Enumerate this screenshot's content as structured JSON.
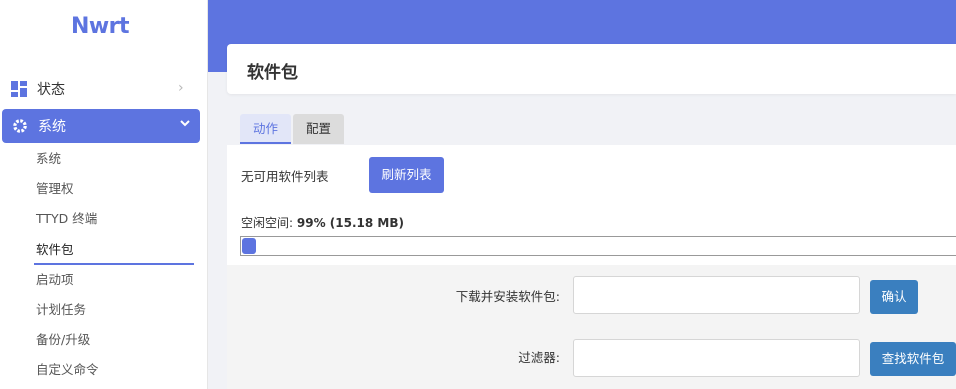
{
  "app": {
    "logo": "Nwrt"
  },
  "sidebar": {
    "status": {
      "label": "状态"
    },
    "system": {
      "label": "系统"
    },
    "submenu": [
      {
        "label": "系统",
        "active": false
      },
      {
        "label": "管理权",
        "active": false
      },
      {
        "label": "TTYD 终端",
        "active": false
      },
      {
        "label": "软件包",
        "active": true
      },
      {
        "label": "启动项",
        "active": false
      },
      {
        "label": "计划任务",
        "active": false
      },
      {
        "label": "备份/升级",
        "active": false
      },
      {
        "label": "自定义命令",
        "active": false
      }
    ]
  },
  "page": {
    "title": "软件包"
  },
  "tabs": [
    {
      "label": "动作",
      "active": true
    },
    {
      "label": "配置",
      "active": false
    }
  ],
  "actions": {
    "no_list_text": "无可用软件列表",
    "refresh_button": "刷新列表",
    "free_space_label": "空闲空间:",
    "free_space_value": "99% (15.18 MB)",
    "used_fraction": 0.02
  },
  "form": {
    "download_label": "下载并安装软件包:",
    "download_value": "",
    "confirm_button": "确认",
    "filter_label": "过滤器:",
    "filter_value": "",
    "find_button": "查找软件包"
  },
  "colors": {
    "accent": "#5d74e0",
    "button_blue": "#3a7fbf"
  }
}
